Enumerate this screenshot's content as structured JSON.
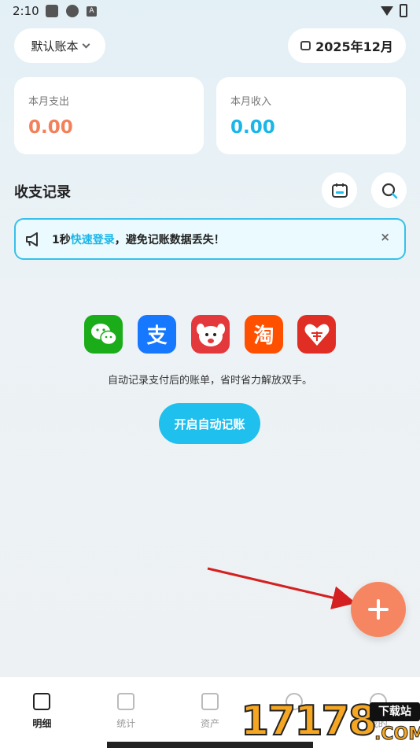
{
  "status_bar": {
    "time": "2:10",
    "a_badge": "A"
  },
  "header": {
    "book_selector": "默认账本",
    "date_selector": "2025年12月"
  },
  "summary": {
    "expense_label": "本月支出",
    "expense_value": "0.00",
    "income_label": "本月收入",
    "income_value": "0.00"
  },
  "records": {
    "title": "收支记录"
  },
  "banner": {
    "prefix": "1秒",
    "link": "快速登录",
    "suffix": "，避免记账数据丢失！",
    "close": "×"
  },
  "apps": [
    {
      "name": "wechat",
      "glyph": ""
    },
    {
      "name": "alipay",
      "glyph": "支"
    },
    {
      "name": "jd",
      "glyph": ""
    },
    {
      "name": "taobao",
      "glyph": "淘"
    },
    {
      "name": "pinduoduo",
      "glyph": ""
    }
  ],
  "auto": {
    "description": "自动记录支付后的账单，省时省力解放双手。",
    "button": "开启自动记账"
  },
  "tabs": [
    {
      "label": "明细",
      "active": true
    },
    {
      "label": "统计",
      "active": false
    },
    {
      "label": "资产",
      "active": false
    },
    {
      "label": "",
      "active": false
    },
    {
      "label": "我的",
      "active": false
    }
  ],
  "watermark": {
    "digits": "17178",
    "box_text": "下载站",
    "suffix": ".COM"
  },
  "colors": {
    "accent": "#1fbfee",
    "expense": "#f2815a",
    "income": "#1ab6e8",
    "fab": "#f68661"
  }
}
